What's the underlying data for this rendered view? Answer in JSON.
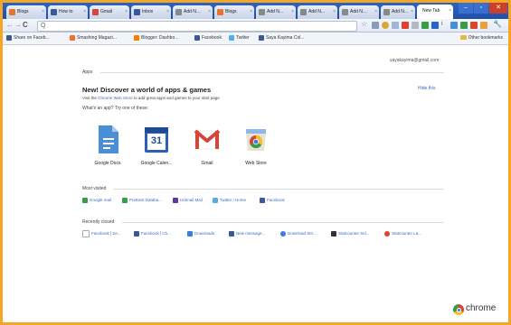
{
  "tabs": [
    {
      "label": "Blogs",
      "color": "#e8752b"
    },
    {
      "label": "How to",
      "color": "#3b5998"
    },
    {
      "label": "Gmail",
      "color": "#d44638"
    },
    {
      "label": "Inbox",
      "color": "#3b5998"
    },
    {
      "label": "Add N...",
      "color": "#888888"
    },
    {
      "label": "Blogs",
      "color": "#e8752b"
    },
    {
      "label": "Add N...",
      "color": "#888888"
    },
    {
      "label": "Add N...",
      "color": "#888888"
    },
    {
      "label": "Add N...",
      "color": "#888888"
    },
    {
      "label": "Add N...",
      "color": "#888888"
    },
    {
      "label": "New Tab",
      "color": "#ffffff"
    }
  ],
  "window": {
    "minimize": "–",
    "maximize": "▫",
    "close": "✕"
  },
  "nav": {
    "back": "←",
    "forward": "→",
    "reload": "C",
    "search": "Q"
  },
  "bookmarks": [
    {
      "label": "Share on Faceb...",
      "color": "#3b5998"
    },
    {
      "label": "Smashing Magazi...",
      "color": "#e8752b"
    },
    {
      "label": "Blogger: Dashbo...",
      "color": "#f57d00"
    },
    {
      "label": "Facebook",
      "color": "#3b5998"
    },
    {
      "label": "Twitter",
      "color": "#55acee"
    },
    {
      "label": "Saya Kayima  Col...",
      "color": "#3b5998"
    }
  ],
  "other_bookmarks": "Other bookmarks",
  "account_email": "sayakayima@gmail.com",
  "apps_section": {
    "title": "Apps",
    "headline": "New! Discover a world of apps & games",
    "visit_prefix": "Visit the",
    "visit_link": "Chrome Web Store",
    "visit_suffix": "to add great apps and games to your start page",
    "whats": "What's an app? Try one of these:",
    "hide": "Hide this",
    "apps": [
      {
        "name": "Google Docs",
        "icon": "google-docs-icon"
      },
      {
        "name": "Google Calen...",
        "icon": "google-calendar-icon",
        "day": "31"
      },
      {
        "name": "Gmail",
        "icon": "gmail-icon"
      },
      {
        "name": "Web Store",
        "icon": "web-store-icon"
      }
    ]
  },
  "most_visited": {
    "title": "Most visited",
    "items": [
      {
        "label": "Google mail",
        "color": "#3c9b46"
      },
      {
        "label": "Prettiest Databa...",
        "color": "#3c9b46"
      },
      {
        "label": "Hotmail Mail",
        "color": "#5b3a9e"
      },
      {
        "label": "Twitter / Home",
        "color": "#55acee"
      },
      {
        "label": "Facebook",
        "color": "#3b5998"
      }
    ]
  },
  "recently_closed": {
    "title": "Recently closed",
    "items": [
      {
        "label": "Facebook | Se...",
        "color": "#aaaaaa"
      },
      {
        "label": "Facebook | Ch...",
        "color": "#3b5998"
      },
      {
        "label": "Downloads",
        "color": "#3d7ae2"
      },
      {
        "label": "New message...",
        "color": "#3b5998"
      },
      {
        "label": "Download Stri...",
        "color": "#3d7ae2"
      },
      {
        "label": "Statcounter Sel...",
        "color": "#333333"
      },
      {
        "label": "Statcounter La...",
        "color": "#d9432f"
      }
    ]
  },
  "brand": "chrome",
  "colors": {
    "frame": "#f5a623",
    "tabbar": "#2c63c6",
    "link": "#3a6bc9"
  }
}
